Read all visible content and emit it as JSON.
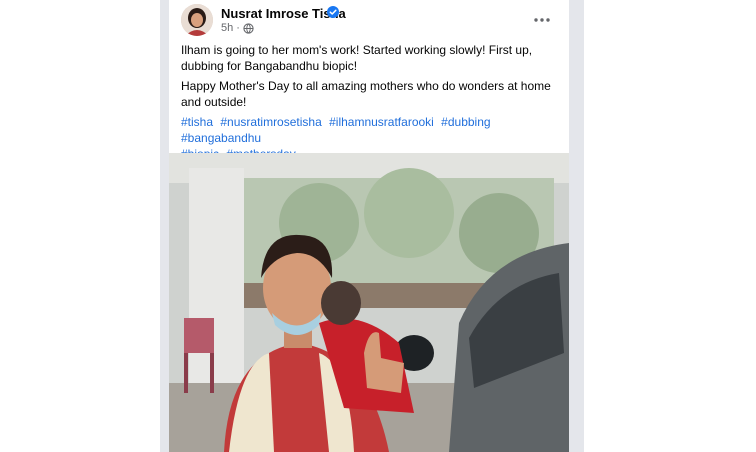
{
  "post": {
    "author": "Nusrat Imrose Tisha",
    "time": "5h",
    "text1": "Ilham is going to her mom's work! Started working slowly! First up, dubbing for Bangabandhu biopic!",
    "text2": "Happy Mother's Day to all amazing mothers who do wonders at home and outside!",
    "hashtags": [
      "#tisha",
      "#nusratimrosetisha",
      "#ilhamnusratfarooki",
      "#dubbing",
      "#bangabandhu",
      "#biopic",
      "#mothersday"
    ]
  },
  "icons": {
    "verified": "verified-badge-icon",
    "audience": "globe-icon",
    "more": "more-options-icon"
  },
  "colors": {
    "link": "#216fdb",
    "verified": "#1877f2",
    "secondary_text": "#65676b",
    "backdrop": "#e4e6eb"
  }
}
